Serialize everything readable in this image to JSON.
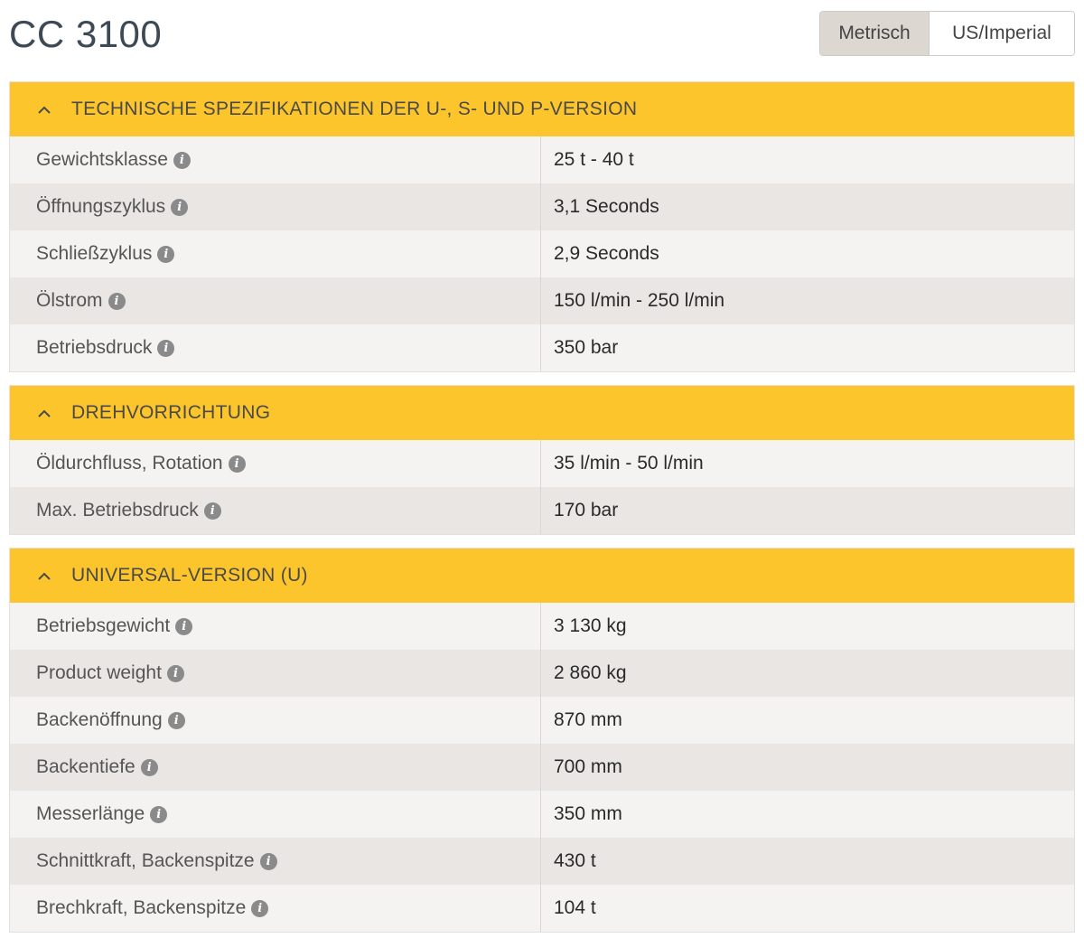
{
  "page": {
    "title": "CC 3100"
  },
  "units": {
    "metric_label": "Metrisch",
    "imperial_label": "US/Imperial",
    "selected": "Metrisch"
  },
  "colors": {
    "header": "#fdc52c",
    "row_light": "#f4f3f1",
    "row_dark": "#e9e6e3",
    "toggle_active": "#ddd7d1"
  },
  "icons": {
    "info": "info-icon",
    "info_glyph": "i",
    "collapse": "chevron-up-icon"
  },
  "sections": [
    {
      "title": "TECHNISCHE SPEZIFIKATIONEN DER U-, S- UND P-VERSION",
      "rows": [
        {
          "label": "Gewichtsklasse",
          "value": "25 t - 40 t"
        },
        {
          "label": "Öffnungszyklus",
          "value": "3,1 Seconds"
        },
        {
          "label": "Schließzyklus",
          "value": "2,9 Seconds"
        },
        {
          "label": "Ölstrom",
          "value": "150 l/min - 250 l/min"
        },
        {
          "label": "Betriebsdruck",
          "value": "350 bar"
        }
      ]
    },
    {
      "title": "DREHVORRICHTUNG",
      "rows": [
        {
          "label": "Öldurchfluss, Rotation",
          "value": "35 l/min - 50 l/min"
        },
        {
          "label": "Max. Betriebsdruck",
          "value": "170 bar"
        }
      ]
    },
    {
      "title": "UNIVERSAL-VERSION (U)",
      "rows": [
        {
          "label": "Betriebsgewicht",
          "value": "3 130 kg"
        },
        {
          "label": "Product weight",
          "value": "2 860 kg"
        },
        {
          "label": "Backenöffnung",
          "value": "870 mm"
        },
        {
          "label": "Backentiefe",
          "value": "700 mm"
        },
        {
          "label": "Messerlänge",
          "value": "350 mm"
        },
        {
          "label": "Schnittkraft, Backenspitze",
          "value": "430 t"
        },
        {
          "label": "Brechkraft, Backenspitze",
          "value": "104 t"
        }
      ]
    }
  ]
}
